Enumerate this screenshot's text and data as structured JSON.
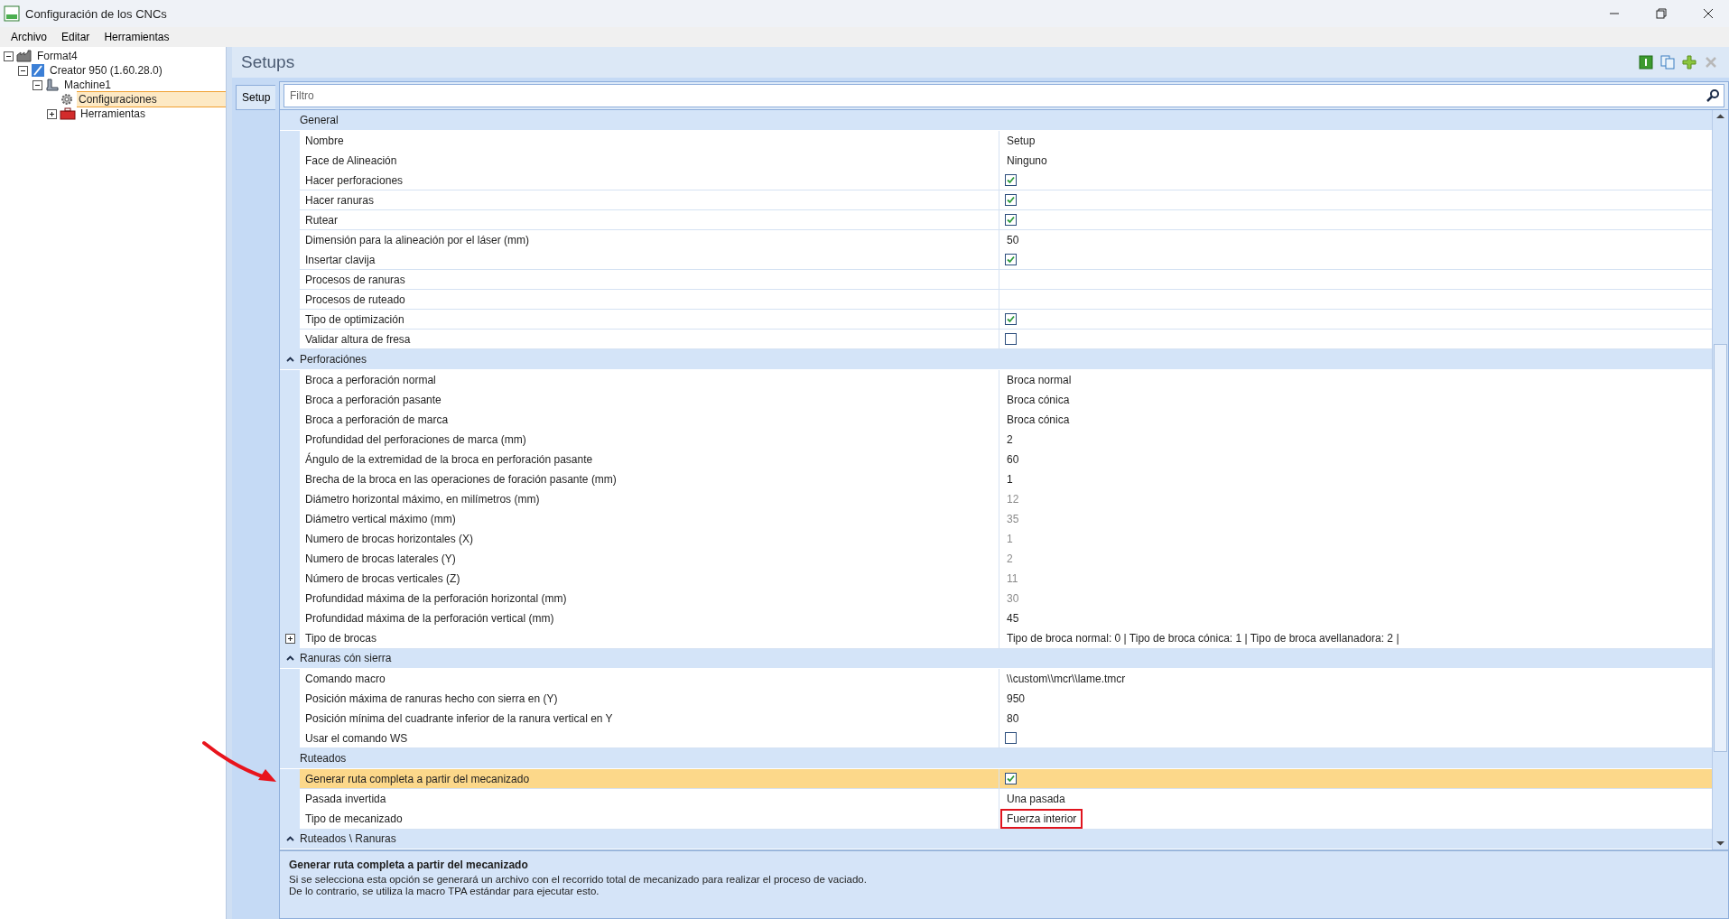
{
  "window": {
    "title": "Configuración de los CNCs"
  },
  "menu": [
    "Archivo",
    "Editar",
    "Herramientas"
  ],
  "tree": [
    {
      "label": "Format4",
      "kind": "project",
      "expanded": true,
      "selected": false,
      "children": [
        {
          "label": "Creator 950 (1.60.28.0)",
          "kind": "product",
          "expanded": true,
          "selected": false,
          "children": [
            {
              "label": "Machine1",
              "kind": "machine",
              "expanded": true,
              "selected": false,
              "children": [
                {
                  "label": "Configuraciones",
                  "kind": "settings",
                  "selected": true
                },
                {
                  "label": "Herramientas",
                  "kind": "tools",
                  "expanded": false,
                  "selected": false
                }
              ]
            }
          ]
        }
      ]
    }
  ],
  "panel": {
    "title": "Setups",
    "toolbar": [
      {
        "kind": "info",
        "disabled": false
      },
      {
        "kind": "copy",
        "disabled": false
      },
      {
        "kind": "add",
        "disabled": false
      },
      {
        "kind": "delete",
        "disabled": true
      }
    ],
    "tabs": [
      {
        "label": "Setup",
        "selected": true
      }
    ],
    "filter": {
      "placeholder": "Filtro"
    }
  },
  "grid": [
    {
      "kind": "group",
      "label": "General",
      "expander": false,
      "selected": false
    },
    {
      "kind": "text",
      "label": "Nombre",
      "value": "Setup",
      "disabled": false,
      "selected": false
    },
    {
      "kind": "text",
      "label": "Face de Alineación",
      "value": "Ninguno",
      "disabled": false,
      "selected": false
    },
    {
      "kind": "check",
      "label": "Hacer perforaciones",
      "checked": true,
      "selected": false
    },
    {
      "kind": "check",
      "label": "Hacer ranuras",
      "checked": true,
      "selected": false
    },
    {
      "kind": "check",
      "label": "Rutear",
      "checked": true,
      "selected": false
    },
    {
      "kind": "text",
      "label": "Dimensión para la alineación por el láser (mm)",
      "value": "50",
      "disabled": false,
      "selected": false
    },
    {
      "kind": "check",
      "label": "Insertar clavija",
      "checked": true,
      "selected": false
    },
    {
      "kind": "text",
      "label": "Procesos de ranuras",
      "disabled": false,
      "selected": false
    },
    {
      "kind": "text",
      "label": "Procesos de ruteado",
      "disabled": false,
      "selected": false
    },
    {
      "kind": "check",
      "label": "Tipo de optimización",
      "checked": true,
      "selected": false
    },
    {
      "kind": "check",
      "label": "Validar altura de fresa",
      "checked": false,
      "selected": false
    },
    {
      "kind": "group",
      "label": "Perforaciónes",
      "expander": true,
      "selected": false
    },
    {
      "kind": "text",
      "label": "Broca a perforación normal",
      "value": "Broca normal",
      "disabled": false,
      "selected": false
    },
    {
      "kind": "text",
      "label": "Broca a perforación pasante",
      "value": "Broca cónica",
      "disabled": false,
      "selected": false
    },
    {
      "kind": "text",
      "label": "Broca a perforación de marca",
      "value": "Broca cónica",
      "disabled": false,
      "selected": false
    },
    {
      "kind": "text",
      "label": "Profundidad del perforaciones de marca (mm)",
      "value": "2",
      "disabled": false,
      "selected": false
    },
    {
      "kind": "text",
      "label": "Ángulo de la extremidad de la broca en perforación pasante",
      "value": "60",
      "disabled": false,
      "selected": false
    },
    {
      "kind": "text",
      "label": "Brecha de la broca en las operaciones de foración pasante (mm)",
      "value": "1",
      "disabled": false,
      "selected": false
    },
    {
      "kind": "text",
      "label": "Diámetro horizontal máximo, en milímetros (mm)",
      "value": "12",
      "disabled": true,
      "selected": false
    },
    {
      "kind": "text",
      "label": "Diámetro vertical máximo (mm)",
      "value": "35",
      "disabled": true,
      "selected": false
    },
    {
      "kind": "text",
      "label": "Numero de brocas horizontales (X)",
      "value": "1",
      "disabled": true,
      "selected": false
    },
    {
      "kind": "text",
      "label": "Numero de brocas laterales (Y)",
      "value": "2",
      "disabled": true,
      "selected": false
    },
    {
      "kind": "text",
      "label": "Número de brocas verticales (Z)",
      "value": "11",
      "disabled": true,
      "selected": false
    },
    {
      "kind": "text",
      "label": "Profundidad máxima de la perforación horizontal (mm)",
      "value": "30",
      "disabled": true,
      "selected": false
    },
    {
      "kind": "text",
      "label": "Profundidad máxima de la perforación vertical (mm)",
      "value": "45",
      "disabled": false,
      "selected": false
    },
    {
      "kind": "text",
      "label": "Tipo de brocas",
      "value": "Tipo de broca normal: 0  |  Tipo de broca cónica: 1  |  Tipo de broca avellanadora: 2  |",
      "disabled": false,
      "expanded": false,
      "selected": false
    },
    {
      "kind": "group",
      "label": "Ranuras cón sierra",
      "expander": true,
      "selected": false
    },
    {
      "kind": "text",
      "label": "Comando macro",
      "value": "\\\\custom\\\\mcr\\\\lame.tmcr",
      "disabled": false,
      "selected": false
    },
    {
      "kind": "text",
      "label": "Posición máxima de ranuras hecho con sierra en (Y)",
      "value": "950",
      "disabled": false,
      "selected": false
    },
    {
      "kind": "text",
      "label": "Posición mínima del cuadrante inferior de la ranura vertical en Y",
      "value": "80",
      "disabled": false,
      "selected": false
    },
    {
      "kind": "check",
      "label": "Usar el comando WS",
      "checked": false,
      "selected": false
    },
    {
      "kind": "group",
      "label": "Ruteados",
      "expander": false,
      "selected": false
    },
    {
      "kind": "check",
      "label": "Generar ruta completa a partir del mecanizado",
      "checked": true,
      "selected": true,
      "pointer": true
    },
    {
      "kind": "text",
      "label": "Pasada invertida",
      "value": "Una pasada",
      "disabled": false,
      "selected": false
    },
    {
      "kind": "text",
      "label": "Tipo de mecanizado",
      "value": "Fuerza interior",
      "disabled": false,
      "selected": false,
      "boxed": true
    },
    {
      "kind": "group",
      "label": "Ruteados \\ Ranuras",
      "expander": true,
      "selected": false
    }
  ],
  "description": {
    "title": "Generar ruta completa a partir del mecanizado",
    "lines": [
      "Si se selecciona esta opción se generará un archivo con el recorrido total de mecanizado para realizar el proceso de vaciado.",
      "De lo contrario, se utiliza la macro TPA estándar para ejecutar esto."
    ]
  }
}
